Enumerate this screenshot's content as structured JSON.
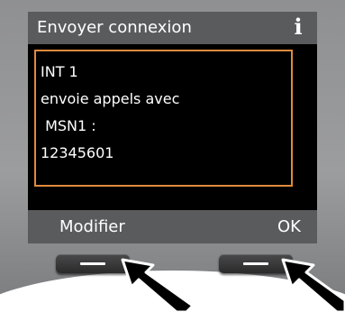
{
  "screen": {
    "title": "Envoyer connexion",
    "info_icon_glyph": "i",
    "message_lines": [
      "INT 1",
      "envoie appels avec",
      " MSN1 :",
      "12345601"
    ]
  },
  "softkeys": {
    "left_label": "Modifier",
    "right_label": "OK"
  },
  "colors": {
    "screen_background": "#000000",
    "title_bar": "#5a5b5d",
    "message_box_border": "#e08a3c",
    "text": "#ffffff",
    "phone_body": "#9c9d9f",
    "hardware_key": "#2f2f30",
    "pointer_arrow": "#000000"
  },
  "icons": {
    "info": "info-icon",
    "left_arrow": "pointer-arrow-icon",
    "right_arrow": "pointer-arrow-icon"
  }
}
